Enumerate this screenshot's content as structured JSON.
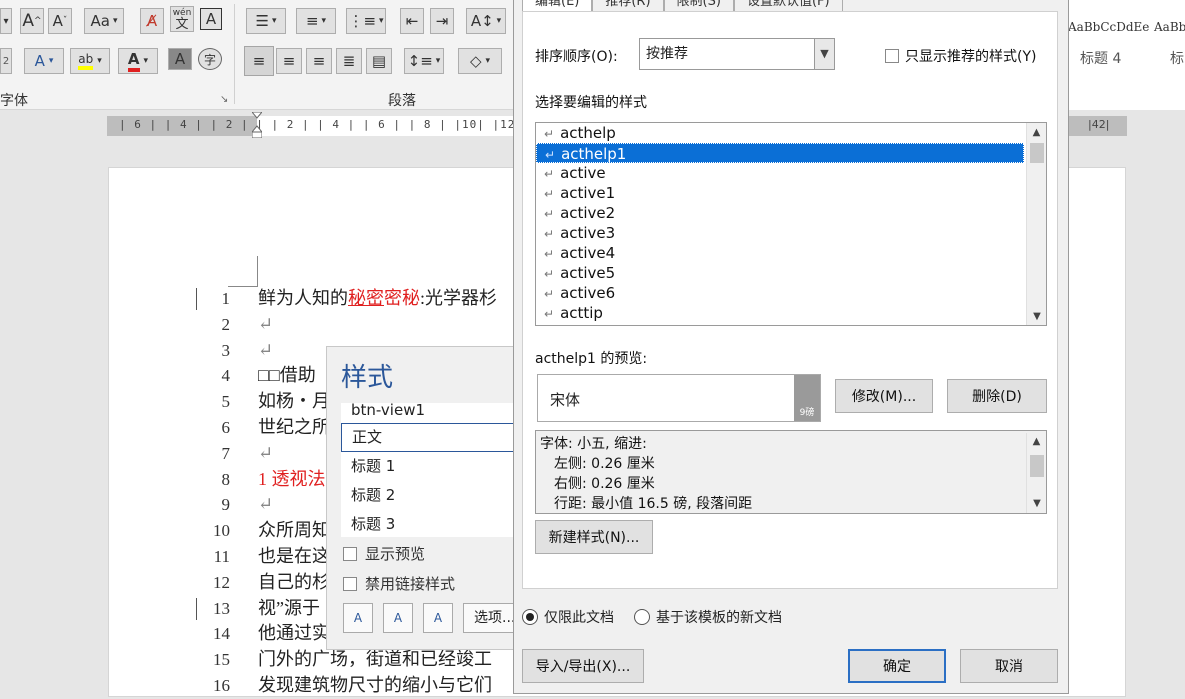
{
  "ribbon": {
    "font_group_label": "字体",
    "paragraph_group_label": "段落",
    "font_size_grow": "A",
    "font_size_shrink": "A",
    "change_case": "Aa",
    "phonetic_top": "wén",
    "phonetic_bottom": "文",
    "char_border": "A",
    "text_effect": "A",
    "highlight": "ab",
    "font_color": "A",
    "char_shading": "A",
    "enclose": "字",
    "styles_gallery": [
      {
        "sample": "AaBbCcDdEe",
        "name": "标题 4"
      },
      {
        "sample": "AaBb",
        "name": "标"
      }
    ]
  },
  "ruler": {
    "text": "| 6 |  | 4 |  | 2 |  |      | 2 |  | 4 |  | 6 |  | 8 |  |10|  |12|",
    "right_text": "|42|"
  },
  "document": {
    "line_numbers": [
      "1",
      "2",
      "3",
      "4",
      "5",
      "6",
      "7",
      "8",
      "9",
      "10",
      "11",
      "12",
      "13",
      "14",
      "15",
      "16"
    ],
    "lines": [
      {
        "a": "鲜为人知的",
        "b": "秘密",
        "c": "密秘",
        "d": ":光学器杉"
      },
      {
        "text": "↵"
      },
      {
        "text": "↵"
      },
      {
        "text": "□□借助"
      },
      {
        "text": "如杨・月"
      },
      {
        "text": "世纪之所"
      },
      {
        "text": "↵"
      },
      {
        "text": "1 透视法"
      },
      {
        "text": "↵"
      },
      {
        "text": "众所周知"
      },
      {
        "text": "也是在这"
      },
      {
        "text": "自己的杉"
      },
      {
        "text": "视”源于"
      },
      {
        "text": "他通过实"
      },
      {
        "text": "门外的广场，街道和已经竣工"
      },
      {
        "text": "发现建筑物尺寸的缩小与它们"
      }
    ]
  },
  "style_pane": {
    "title": "样式",
    "items": [
      "btn-view1",
      "正文",
      "标题 1",
      "标题 2",
      "标题 3"
    ],
    "selected": "正文",
    "show_preview": "显示预览",
    "disable_linked": "禁用链接样式",
    "new_style_icon": "A",
    "inspector_icon": "A",
    "manage_icon": "A",
    "options_label": "选项..."
  },
  "dialog": {
    "tabs": [
      "编辑(E)",
      "推荐(R)",
      "限制(S)",
      "设置默认值(F)"
    ],
    "sort_label": "排序顺序(O):",
    "sort_value": "按推荐",
    "only_recommended": "只显示推荐的样式(Y)",
    "select_label": "选择要编辑的样式",
    "styles": [
      "acthelp",
      "acthelp1",
      "active",
      "active1",
      "active2",
      "active3",
      "active4",
      "active5",
      "active6",
      "acttip"
    ],
    "selected_style": "acthelp1",
    "return_mark": "↵",
    "preview_label": "acthelp1 的预览:",
    "preview_font": "宋体",
    "preview_size": "9磅",
    "modify_button": "修改(M)...",
    "delete_button": "删除(D)",
    "description": [
      "字体: 小五, 缩进:",
      "左侧:  0.26 厘米",
      "右侧:  0.26 厘米",
      "行距: 最小值 16.5 磅, 段落间距"
    ],
    "new_style_button": "新建样式(N)...",
    "radio_doc": "仅限此文档",
    "radio_template": "基于该模板的新文档",
    "import_export_button": "导入/导出(X)...",
    "ok_button": "确定",
    "cancel_button": "取消"
  }
}
